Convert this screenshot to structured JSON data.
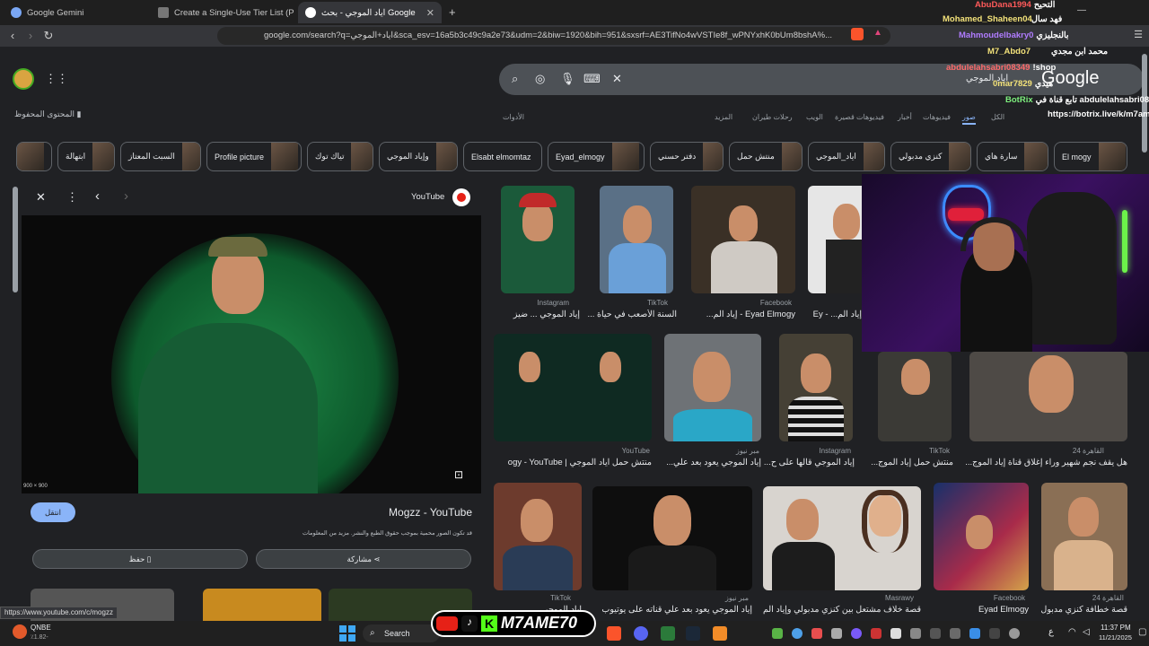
{
  "tabs": [
    {
      "label": "Google Gemini"
    },
    {
      "label": "Create a Single-Use Tier List (Private"
    },
    {
      "label": "اياد الموجي - بحث Google",
      "close": "✕"
    }
  ],
  "address": {
    "url": "google.com/search?q=اياد+الموجي&sca_esv=16a5b3c49c9a2e73&udm=2&biw=1920&bih=951&sxsrf=AE3TifNo4wVSTIe8f_wPNYxhK0bUm8bshA%..."
  },
  "google": {
    "logo": "Google",
    "query": "اياد الموجي",
    "saved": "المحتوى المحفوظ",
    "nav": [
      "الكل",
      "صور",
      "فيديوهات",
      "أخبار",
      "فيديوهات قصيرة",
      "الويب",
      "رحلات طيران",
      "المزيد",
      "الأدوات"
    ],
    "chips": [
      "El mogy",
      "سارة هاي",
      "كنزي مدبولي",
      "اياد_الموجي",
      "منتش حمل",
      "دفتر حسني",
      "Eyad_elmogy",
      "Elsabt elmomtaz",
      "وإياد الموجي",
      "تياك توك",
      "Profile picture",
      "السبت المعتاز",
      "ابتهالة"
    ]
  },
  "preview": {
    "source": "YouTube",
    "dims": "900 × 900",
    "visit": "انتقل",
    "title": "Mogzz - YouTube",
    "copyright": "قد تكون الصور محمية بموجب حقوق الطبع والنشر. مزيد من المعلومات",
    "share": "مشاركة",
    "save": "حفظ"
  },
  "results": [
    {
      "src": "Instagram",
      "title": "إياد الموجي ... ضيز"
    },
    {
      "src": "TikTok",
      "title": "السنة الأصعب في حياة ..."
    },
    {
      "src": "Facebook",
      "title": "Eyad Elmogy - إياد الم..."
    },
    {
      "src": "",
      "title": "إياد الم... - Ey"
    },
    {
      "src": "YouTube",
      "title": "منتش حمل اياد الموجي | ogy - YouTube"
    },
    {
      "src": "مبر نيوز",
      "title": "إياد الموجي يعود بعد علي..."
    },
    {
      "src": "Instagram",
      "title": "إياد الموجي قالها على ح..."
    },
    {
      "src": "TikTok",
      "title": "منتش حمل إياد الموج..."
    },
    {
      "src": "القاهرة 24",
      "title": "هل يقف نجم شهير وراء إغلاق قناة إياد الموج..."
    },
    {
      "src": "TikTok",
      "title": "إياد الموجي"
    },
    {
      "src": "مبر نيوز",
      "title": "إياد الموجي يعود بعد علي قناته على يوتيوب"
    },
    {
      "src": "Masrawy",
      "title": "قصة خلاف مشتعل بين كنزي مدبولي وإياد الم..."
    },
    {
      "src": "Facebook",
      "title": "Eyad Elmogy"
    },
    {
      "src": "القاهرة 24",
      "title": "قصة خطافة كنزي مدبول..."
    }
  ],
  "chat": [
    {
      "user": "AbuDana1994",
      "msg": "التحيح"
    },
    {
      "user": "",
      "msg": "فهد سال"
    },
    {
      "user": "Mohamed_Shaheen04",
      "msg": ""
    },
    {
      "user": "Mahmoudelbakry0",
      "msg": "بالنجليزي"
    },
    {
      "user": "M7_Abdo7",
      "msg": ""
    },
    {
      "user": "",
      "msg": "محمد ابن مجدي"
    },
    {
      "user": "abdulelahsabri08349",
      "msg": "!shop"
    },
    {
      "user": "0mar7829",
      "msg": "هيدي"
    },
    {
      "user": "BotRix",
      "msg": "تابع قناة في abdulelahsabri08349"
    },
    {
      "user": "",
      "msg": "https://botrix.live/k/m7ame"
    }
  ],
  "stream": {
    "brand": "M7AME70"
  },
  "status_url": "https://www.youtube.com/c/mogzz",
  "taskbar": {
    "weather_title": "QNBE",
    "weather_sub": "٪1.82-",
    "search": "Search",
    "time": "11:37 PM",
    "date": "11/21/2025",
    "lang": "ع"
  }
}
